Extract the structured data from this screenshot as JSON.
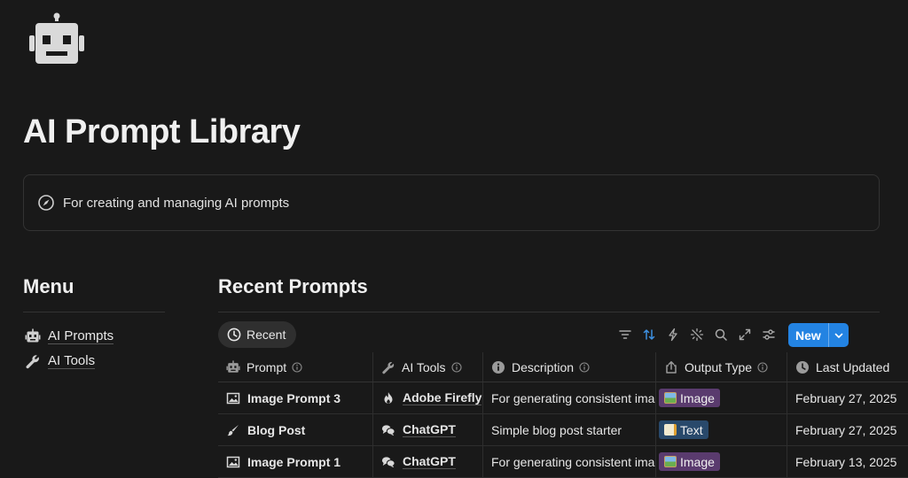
{
  "page": {
    "icon": "robot-icon",
    "title": "AI Prompt Library",
    "callout": {
      "icon": "compass-icon",
      "text": "For creating and managing AI prompts"
    }
  },
  "menu": {
    "heading": "Menu",
    "items": [
      {
        "icon": "robot-icon",
        "label": "AI Prompts"
      },
      {
        "icon": "wrench-icon",
        "label": "AI Tools"
      }
    ]
  },
  "recent": {
    "heading": "Recent Prompts",
    "view_tab": {
      "icon": "clock-icon",
      "label": "Recent"
    },
    "toolbar_icons": [
      "filter-icon",
      "sort-icon",
      "automation-bolt-icon",
      "ai-sparkle-icon",
      "search-icon",
      "expand-icon",
      "settings-sliders-icon"
    ],
    "new_button": {
      "label": "New"
    },
    "columns": [
      {
        "icon": "robot-icon",
        "label": "Prompt"
      },
      {
        "icon": "wrench-icon",
        "label": "AI Tools"
      },
      {
        "icon": "info-icon",
        "label": "Description"
      },
      {
        "icon": "share-icon",
        "label": "Output Type"
      },
      {
        "icon": "clock-icon",
        "label": "Last Updated"
      }
    ],
    "rows": [
      {
        "prompt": "Image Prompt 3",
        "prompt_icon": "image-icon",
        "tool": "Adobe Firefly",
        "tool_icon": "flame-icon",
        "description": "For generating consistent images",
        "output_type": "Image",
        "output_color": "#5a3b6e",
        "updated": "February 27, 2025"
      },
      {
        "prompt": "Blog Post",
        "prompt_icon": "brush-icon",
        "tool": "ChatGPT",
        "tool_icon": "chat-bubbles-icon",
        "description": "Simple blog post starter",
        "output_type": "Text",
        "output_color": "#29496b",
        "updated": "February 27, 2025"
      },
      {
        "prompt": "Image Prompt 1",
        "prompt_icon": "image-icon",
        "tool": "ChatGPT",
        "tool_icon": "chat-bubbles-icon",
        "description": "For generating consistent images",
        "output_type": "Image",
        "output_color": "#5a3b6e",
        "updated": "February 13, 2025"
      }
    ]
  },
  "colors": {
    "background": "#191919",
    "accent": "#2383e2",
    "text": "#e6e6e6",
    "muted": "#9b9b9b",
    "border": "#333333"
  }
}
